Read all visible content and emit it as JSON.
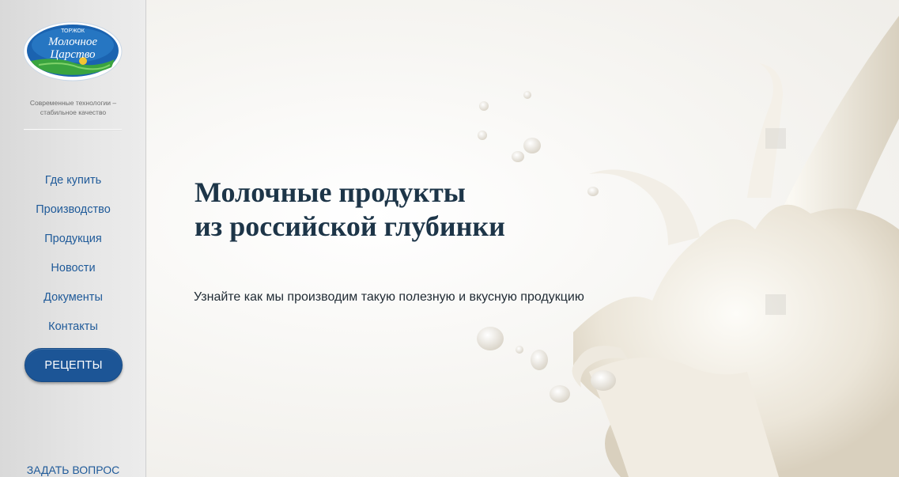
{
  "sidebar": {
    "logo": {
      "top_text": "ТОРЖОК",
      "main_line1": "Молочное",
      "main_line2": "Царство"
    },
    "tagline_line1": "Современные технологии –",
    "tagline_line2": "стабильное качество",
    "nav": [
      {
        "label": "Где купить"
      },
      {
        "label": "Производство"
      },
      {
        "label": "Продукция"
      },
      {
        "label": "Новости"
      },
      {
        "label": "Документы"
      },
      {
        "label": "Контакты"
      }
    ],
    "recipes_label": "РЕЦЕПТЫ",
    "ask_label": "ЗАДАТЬ ВОПРОС"
  },
  "hero": {
    "title_line1": "Молочные продукты",
    "title_line2": "из российской глубинки",
    "subtitle": "Узнайте как мы производим такую полезную и вкусную продукцию"
  },
  "colors": {
    "accent": "#1c5596",
    "nav_link": "#1f5a99",
    "sidebar_bg": "#e0e0e0",
    "title": "#1d3548"
  }
}
